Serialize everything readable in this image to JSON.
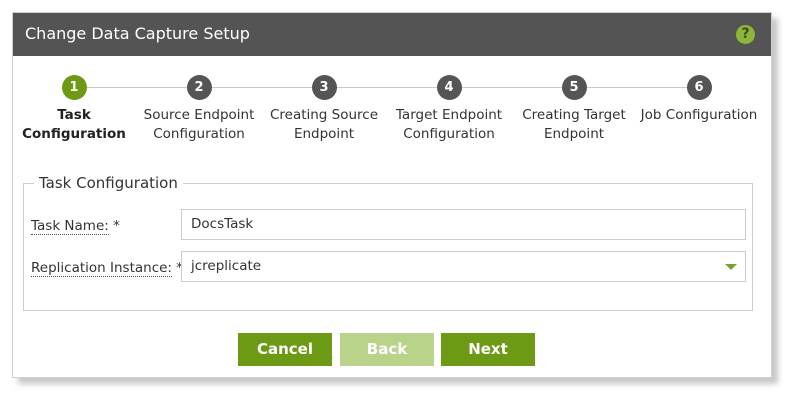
{
  "dialog": {
    "title": "Change Data Capture Setup",
    "help_icon": "?"
  },
  "steps": [
    {
      "number": "1",
      "label_line1": "Task",
      "label_line2": "Configuration",
      "active": true
    },
    {
      "number": "2",
      "label_line1": "Source Endpoint",
      "label_line2": "Configuration",
      "active": false
    },
    {
      "number": "3",
      "label_line1": "Creating Source",
      "label_line2": "Endpoint",
      "active": false
    },
    {
      "number": "4",
      "label_line1": "Target Endpoint",
      "label_line2": "Configuration",
      "active": false
    },
    {
      "number": "5",
      "label_line1": "Creating Target",
      "label_line2": "Endpoint",
      "active": false
    },
    {
      "number": "6",
      "label_line1": "Job Configuration",
      "label_line2": "",
      "active": false
    }
  ],
  "task_config": {
    "legend": "Task Configuration",
    "task_name_label": "Task Name:",
    "task_name_required": " *",
    "task_name_value": "DocsTask",
    "replication_label": "Replication Instance:",
    "replication_required": " *",
    "replication_value": "jcreplicate"
  },
  "buttons": {
    "cancel": "Cancel",
    "back": "Back",
    "next": "Next"
  },
  "colors": {
    "titlebar": "#545454",
    "accent": "#6d9a14",
    "accent_disabled": "#b9d38a",
    "inactive_step": "#555555"
  }
}
